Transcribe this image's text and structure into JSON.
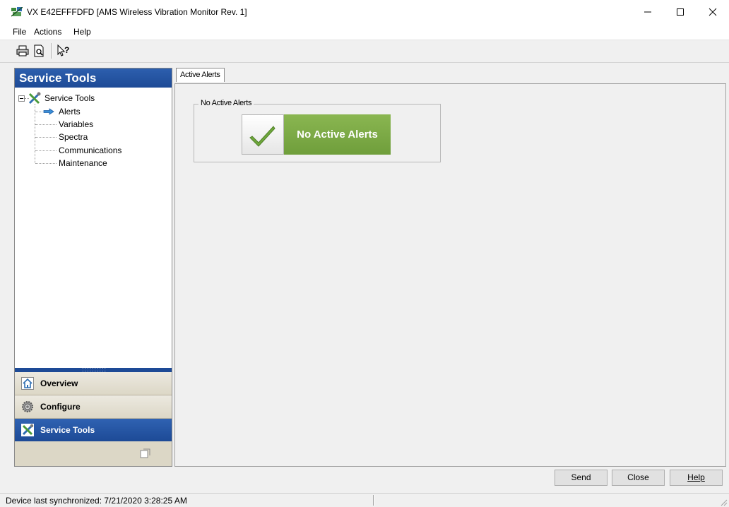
{
  "window": {
    "title": "VX E42EFFFDFD [AMS Wireless Vibration Monitor Rev. 1]"
  },
  "menu": {
    "items": [
      "File",
      "Actions",
      "Help"
    ]
  },
  "toolbar": {
    "icons": [
      "print-icon",
      "print-preview-icon",
      "context-help-icon"
    ]
  },
  "nav": {
    "header": "Service Tools",
    "tree": {
      "root": "Service Tools",
      "children": [
        "Alerts",
        "Variables",
        "Spectra",
        "Communications",
        "Maintenance"
      ],
      "selected": "Alerts"
    },
    "buttons": [
      "Overview",
      "Configure",
      "Service Tools"
    ],
    "active_button": "Service Tools"
  },
  "main": {
    "tab": "Active Alerts",
    "group_label": "No Active Alerts",
    "alert_text": "No Active Alerts",
    "alert_color": "#7bab45"
  },
  "buttons": {
    "send": "Send",
    "close": "Close",
    "help": "Help"
  },
  "status": {
    "text": "Device last synchronized: 7/21/2020 3:28:25 AM"
  },
  "colors": {
    "nav_blue": "#1d4a96",
    "alert_green": "#7bab45"
  }
}
